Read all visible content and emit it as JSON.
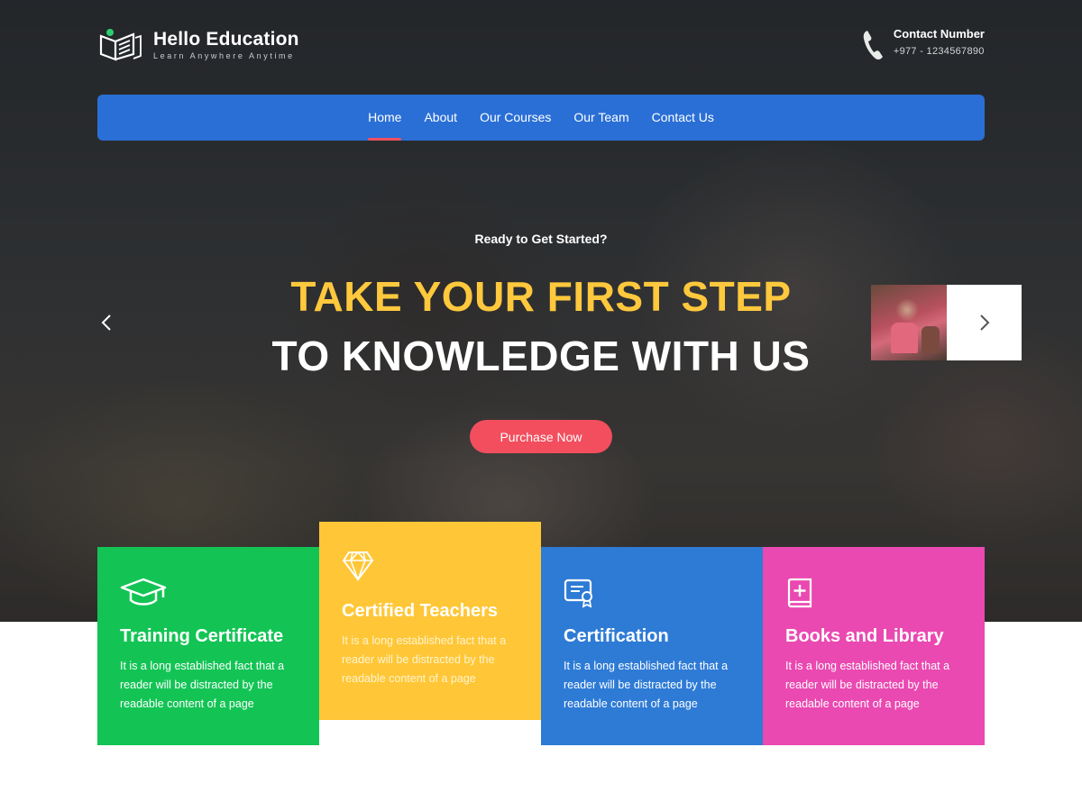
{
  "brand": {
    "name": "Hello Education",
    "tagline": "Learn Anywhere Anytime"
  },
  "contact": {
    "label": "Contact Number",
    "number": "+977 - 1234567890"
  },
  "nav": {
    "items": [
      {
        "label": "Home",
        "active": true
      },
      {
        "label": "About",
        "active": false
      },
      {
        "label": "Our Courses",
        "active": false
      },
      {
        "label": "Our Team",
        "active": false
      },
      {
        "label": "Contact Us",
        "active": false
      }
    ]
  },
  "hero": {
    "pretitle": "Ready to Get Started?",
    "title_line1": "TAKE YOUR FIRST STEP",
    "title_line2": "TO KNOWLEDGE WITH US",
    "cta_label": "Purchase Now"
  },
  "features": [
    {
      "title": "Training Certificate",
      "description": "It is a long established fact that a reader will be distracted by the readable content of a page",
      "icon": "graduation-cap-icon",
      "color": "#13c455"
    },
    {
      "title": "Certified Teachers",
      "description": "It is a long established fact that a reader will be distracted by the readable content of a page",
      "icon": "diamond-icon",
      "color": "#ffc737"
    },
    {
      "title": "Certification",
      "description": "It is a long established fact that a reader will be distracted by the readable content of a page",
      "icon": "certificate-icon",
      "color": "#2e7bd6"
    },
    {
      "title": "Books and Library",
      "description": "It is a long established fact that a reader will be distracted by the readable content of a page",
      "icon": "book-plus-icon",
      "color": "#ea49b1"
    }
  ],
  "colors": {
    "nav": "#2a6fd6",
    "accent": "#f24e5e",
    "highlight": "#ffc83d"
  }
}
